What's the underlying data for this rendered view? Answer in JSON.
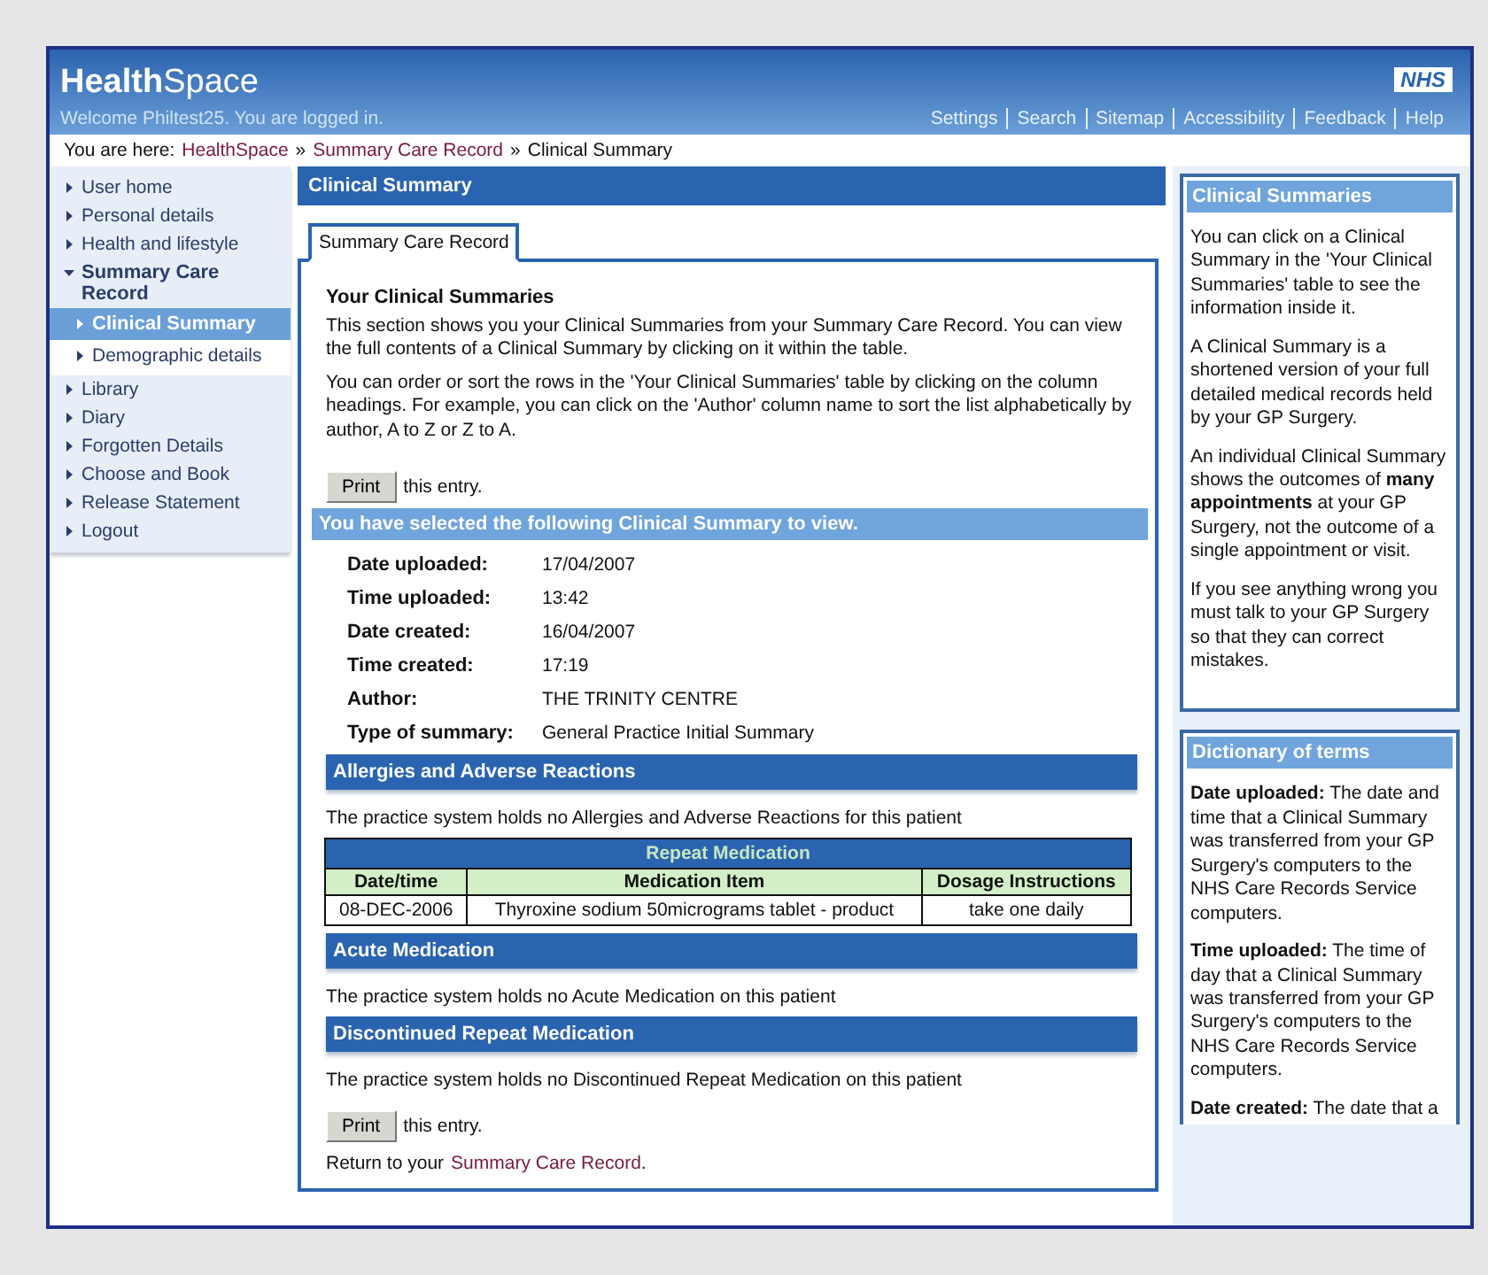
{
  "header": {
    "logo": "**Health**Space",
    "badge": "NHS",
    "welcome": "Welcome Philtest25. You are logged in.",
    "links": [
      "Settings",
      "Search",
      "Sitemap",
      "Accessibility",
      "Feedback",
      "Help"
    ]
  },
  "breadcrumb": {
    "label": "You are here:",
    "items": [
      {
        "text": "HealthSpace",
        "link": true
      },
      {
        "text": "Summary Care Record",
        "link": true
      },
      {
        "text": "Clinical Summary",
        "link": false
      }
    ],
    "separator": "»"
  },
  "sidebar": {
    "items": [
      {
        "label": "User home",
        "selected": false
      },
      {
        "label": "Personal details",
        "selected": false
      },
      {
        "label": "Health and lifestyle",
        "selected": false
      },
      {
        "label": "Summary Care Record",
        "selected": false,
        "expanded": true,
        "children": [
          {
            "label": "Clinical Summary",
            "selected": true
          },
          {
            "label": "Demographic details",
            "selected": false
          }
        ]
      },
      {
        "label": "Library",
        "selected": false
      },
      {
        "label": "Diary",
        "selected": false
      },
      {
        "label": "Forgotten Details",
        "selected": false
      },
      {
        "label": "Choose and Book",
        "selected": false
      },
      {
        "label": "Release Statement",
        "selected": false
      },
      {
        "label": "Logout",
        "selected": false
      }
    ]
  },
  "main": {
    "title": "Clinical Summary",
    "tabs": [
      {
        "label": "Summary Care Record",
        "selected": true
      }
    ],
    "heading": "Your Clinical Summaries",
    "intro": [
      "This section shows you your Clinical Summaries from your Summary Care Record. You can view the full contents of a Clinical Summary by clicking on it within the table.",
      "You can order or sort the rows in the 'Your Clinical Summaries' table by clicking on the column headings. For example, you can click on the 'Author' column name to sort the list alphabetically by author, A to Z or Z to A."
    ],
    "print_button": "Print",
    "print_text": "this entry.",
    "selected_banner": "You have selected the following Clinical Summary to view.",
    "details": [
      {
        "label": "Date uploaded:",
        "value": "17/04/2007"
      },
      {
        "label": "Time uploaded:",
        "value": "13:42"
      },
      {
        "label": "Date created:",
        "value": "16/04/2007"
      },
      {
        "label": "Time created:",
        "value": "17:19"
      },
      {
        "label": "Author:",
        "value": "THE TRINITY CENTRE"
      },
      {
        "label": "Type of summary:",
        "value": "General Practice Initial Summary"
      }
    ],
    "sections": [
      {
        "kind": "heading",
        "text": "Allergies and Adverse Reactions"
      },
      {
        "kind": "note",
        "text": "The practice system holds no Allergies and Adverse Reactions for this patient"
      },
      {
        "kind": "table",
        "title": "Repeat Medication",
        "columns": [
          "Date/time",
          "Medication Item",
          "Dosage Instructions"
        ],
        "rows": [
          [
            "08-DEC-2006",
            "Thyroxine sodium 50micrograms tablet - product",
            "take one daily"
          ]
        ]
      },
      {
        "kind": "heading",
        "text": "Acute Medication"
      },
      {
        "kind": "note",
        "text": "The practice system holds no Acute Medication on this patient"
      },
      {
        "kind": "heading",
        "text": "Discontinued Repeat Medication"
      },
      {
        "kind": "note",
        "text": "The practice system holds no Discontinued Repeat Medication on this patient"
      }
    ],
    "print_button_2": "Print",
    "print_text_2": "this entry.",
    "return_text": "Return to your",
    "return_link": "Summary Care Record",
    "return_end": "."
  },
  "panels": [
    {
      "title": "Clinical Summaries",
      "paragraphs": [
        "You can click on a Clinical Summary in the 'Your Clinical Summaries' table to see the information inside it.",
        "A Clinical Summary is a shortened version of your full detailed medical records held by your GP Surgery.",
        "An individual Clinical Summary shows the outcomes of **many appointments** at your GP Surgery, not the outcome of a single appointment or visit.",
        "If you see anything wrong you must talk to your GP Surgery so that they can correct mistakes."
      ]
    },
    {
      "title": "Dictionary of terms",
      "paragraphs": [
        "**Date uploaded:** The date and time that a Clinical Summary was transferred from your GP Surgery's computers to the NHS Care Records Service computers.",
        "**Time uploaded:** The time of day that a Clinical Summary was transferred from your GP Surgery's computers to the NHS Care Records Service computers.",
        "**Date created:** The date that a"
      ]
    }
  ]
}
